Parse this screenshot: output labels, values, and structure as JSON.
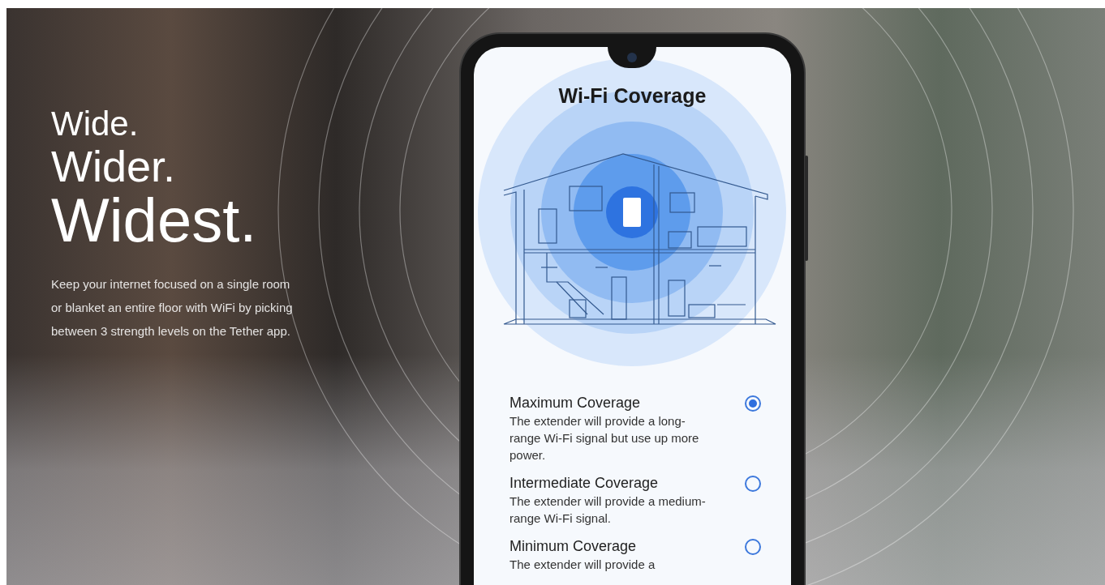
{
  "hero": {
    "headline": [
      "Wide.",
      "Wider.",
      "Widest."
    ],
    "body": "Keep your internet focused on a single room or blanket an entire floor with WiFi by picking between 3 strength levels on the Tether app."
  },
  "phone": {
    "screen_title": "Wi-Fi Coverage",
    "options": [
      {
        "title": "Maximum Coverage",
        "description": "The extender will provide a long-range Wi-Fi signal but use up more power.",
        "selected": true
      },
      {
        "title": "Intermediate Coverage",
        "description": "The extender will provide a medium-range Wi-Fi signal.",
        "selected": false
      },
      {
        "title": "Minimum Coverage",
        "description": "The extender will provide a",
        "selected": false
      }
    ]
  }
}
